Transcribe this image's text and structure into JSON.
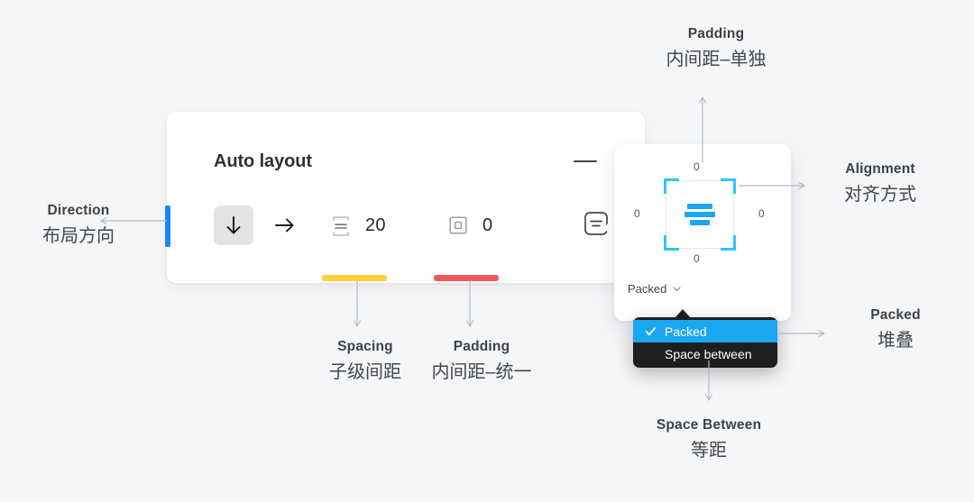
{
  "background": "#f5f6f8",
  "accent": {
    "blue": "#1ba7f0",
    "cyan": "#2ec5ff",
    "yellow": "#fbd13d",
    "red": "#ed5a5a",
    "dark": "#1e1e1e"
  },
  "panel": {
    "title": "Auto layout",
    "minimize_icon": "minus-icon",
    "direction": {
      "selected_icon": "arrow-down-icon",
      "unselected_icon": "arrow-right-icon"
    },
    "spacing": {
      "icon": "vertical-gap-icon",
      "value": "20"
    },
    "padding": {
      "icon": "padding-square-icon",
      "value": "0"
    },
    "alignment_button_icon": "align-center-box-icon"
  },
  "popover": {
    "padding_top": "0",
    "padding_right": "0",
    "padding_bottom": "0",
    "padding_left": "0",
    "alignment_icon": "align-center-bars-icon",
    "packed_label": "Packed",
    "chevron_icon": "chevron-down-icon"
  },
  "dropdown": {
    "items": [
      {
        "label": "Packed",
        "selected": true,
        "check_icon": "check-icon"
      },
      {
        "label": "Space between",
        "selected": false
      }
    ]
  },
  "annotations": [
    {
      "id": "direction",
      "en": "Direction",
      "cn": "布局方向"
    },
    {
      "id": "padding_top",
      "en": "Padding",
      "cn": "内间距–单独"
    },
    {
      "id": "alignment",
      "en": "Alignment",
      "cn": "对齐方式"
    },
    {
      "id": "packed",
      "en": "Packed",
      "cn": "堆叠"
    },
    {
      "id": "spacing",
      "en": "Spacing",
      "cn": "子级间距"
    },
    {
      "id": "padding_uni",
      "en": "Padding",
      "cn": "内间距–统一"
    },
    {
      "id": "space_between",
      "en": "Space Between",
      "cn": "等距"
    }
  ]
}
